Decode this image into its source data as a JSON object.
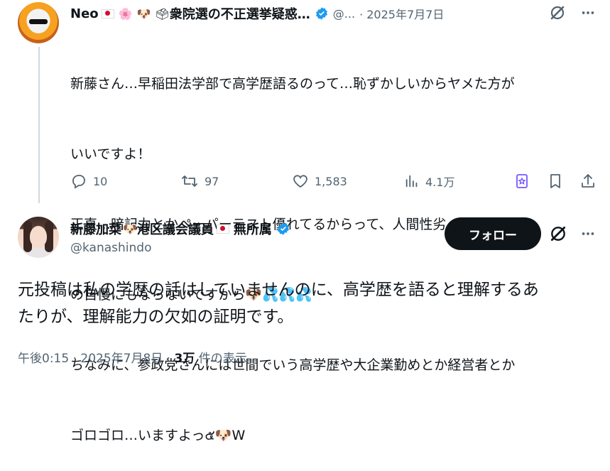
{
  "tweet1": {
    "author_name": "Neo",
    "author_name_suffix": "衆院選の不正選挙疑惑…",
    "emojis": {
      "blossom": "🌸",
      "dog": "🐶",
      "ballot": "🗳"
    },
    "handle": "@...",
    "date": "· 2025年7月7日",
    "lines": [
      "新藤さん…早稲田法学部で高学歴語るのって…恥ずかしいからヤメた方が",
      "いいですよ！",
      "正直…暗記力とかペーパーテスト優れてるからって、人間性劣ってたら何",
      "の自慢にもならないですから🐶💦💦💦",
      "ちなみに、参政党さんには世間でいう高学歴や大企業勤めとか経営者とか",
      "ゴロゴロ…いますよっ๕🐶W"
    ],
    "actions": {
      "replies": "10",
      "retweets": "97",
      "likes": "1,583",
      "views": "4.1万"
    }
  },
  "tweet2": {
    "author_name": "新藤加菜",
    "author_name_mid": "港区議会議員",
    "author_name_tail": "無所属",
    "dog_emoji": "🐶",
    "handle": "@kanashindo",
    "follow_label": "フォロー",
    "lines": [
      "元投稿は私の学歴の話はしていませんのに、高学歴を語ると理解するあ",
      "たりが、理解能力の欠如の証明です。"
    ],
    "time": "午後0:15 · 2025年7月8日 · ",
    "views_count": "3万",
    "views_label": " 件の表示"
  },
  "colors": {
    "verified": "#1d9bf0",
    "text": "#0f1419",
    "muted": "#536471",
    "accent_purple": "#7856ff"
  },
  "icons": [
    "verified-badge-icon",
    "grok-icon",
    "more-icon",
    "reply-icon",
    "retweet-icon",
    "like-icon",
    "views-icon",
    "grok-save-icon",
    "bookmark-icon",
    "share-icon"
  ]
}
